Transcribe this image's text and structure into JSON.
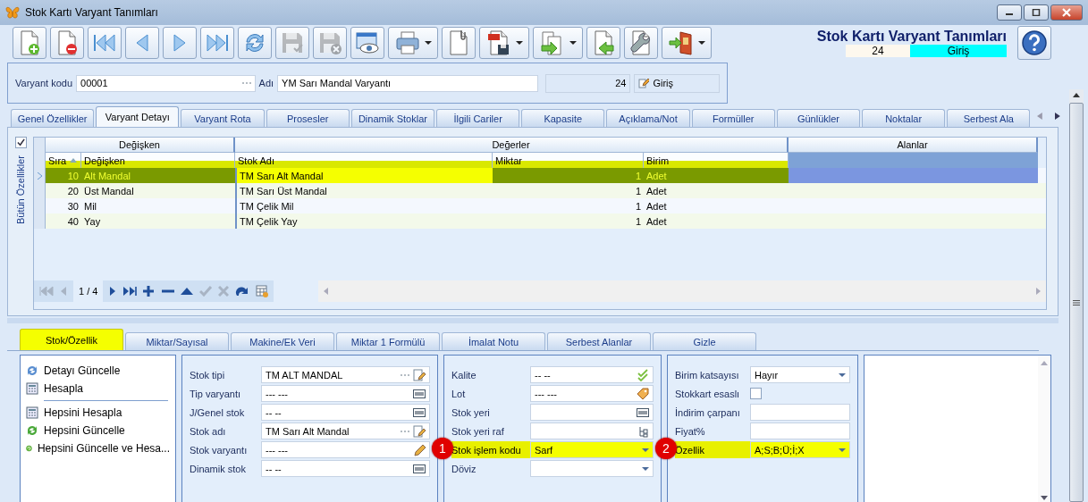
{
  "window": {
    "title": "Stok Kartı Varyant Tanımları"
  },
  "toolbar": [
    {
      "kind": "new",
      "disabled": false,
      "dropdown": false
    },
    {
      "kind": "delete",
      "disabled": false,
      "dropdown": false
    },
    {
      "kind": "first",
      "disabled": false,
      "dropdown": false
    },
    {
      "kind": "prev",
      "disabled": false,
      "dropdown": false
    },
    {
      "kind": "next",
      "disabled": false,
      "dropdown": false
    },
    {
      "kind": "last",
      "disabled": false,
      "dropdown": false
    },
    {
      "kind": "refresh",
      "disabled": false,
      "dropdown": false
    },
    {
      "kind": "save",
      "disabled": true,
      "dropdown": false
    },
    {
      "kind": "cancel",
      "disabled": true,
      "dropdown": false
    },
    {
      "kind": "preview",
      "disabled": false,
      "dropdown": false
    },
    {
      "kind": "print",
      "disabled": false,
      "dropdown": true
    },
    {
      "kind": "attach",
      "disabled": false,
      "dropdown": false
    },
    {
      "kind": "pdf",
      "disabled": false,
      "dropdown": true
    },
    {
      "kind": "export",
      "disabled": false,
      "dropdown": true
    },
    {
      "kind": "import",
      "disabled": false,
      "dropdown": false
    },
    {
      "kind": "tools",
      "disabled": false,
      "dropdown": false
    },
    {
      "kind": "exit",
      "disabled": false,
      "dropdown": true
    }
  ],
  "header": {
    "title": "Stok Kartı Varyant Tanımları",
    "record_no": "24",
    "mode": "Giriş"
  },
  "form": {
    "code_label": "Varyant kodu",
    "code": "00001",
    "name_label": "Adı",
    "name": "YM Sarı Mandal Varyantı",
    "count": "24",
    "mode_button": "Giriş"
  },
  "tabs": [
    {
      "label": "Genel Özellikler",
      "selected": false
    },
    {
      "label": "Varyant Detayı",
      "selected": true
    },
    {
      "label": "Varyant Rota",
      "selected": false
    },
    {
      "label": "Prosesler",
      "selected": false
    },
    {
      "label": "Dinamik Stoklar",
      "selected": false
    },
    {
      "label": "İlgili Cariler",
      "selected": false
    },
    {
      "label": "Kapasite",
      "selected": false
    },
    {
      "label": "Açıklama/Not",
      "selected": false
    },
    {
      "label": "Formüller",
      "selected": false
    },
    {
      "label": "Günlükler",
      "selected": false
    },
    {
      "label": "Noktalar",
      "selected": false
    },
    {
      "label": "Serbest Ala",
      "selected": false
    }
  ],
  "grid": {
    "side_label": "Bütün Özellikler",
    "select_all_checked": true,
    "bands": [
      "Değişken",
      "Değerler",
      "Alanlar"
    ],
    "columns": [
      "Sıra",
      "Değişken",
      "Stok Adı",
      "Miktar",
      "Birim"
    ],
    "rows": [
      {
        "sira": "10",
        "degisken": "Alt Mandal",
        "stok_adi": "TM Sarı Alt Mandal",
        "miktar": "1",
        "birim": "Adet",
        "selected": true
      },
      {
        "sira": "20",
        "degisken": "Üst Mandal",
        "stok_adi": "TM Sarı Üst Mandal",
        "miktar": "1",
        "birim": "Adet",
        "selected": false
      },
      {
        "sira": "30",
        "degisken": "Mil",
        "stok_adi": "TM Çelik Mil",
        "miktar": "1",
        "birim": "Adet",
        "selected": false
      },
      {
        "sira": "40",
        "degisken": "Yay",
        "stok_adi": "TM Çelik Yay",
        "miktar": "1",
        "birim": "Adet",
        "selected": false
      }
    ],
    "page": "1 / 4"
  },
  "lower_tabs": [
    {
      "label": "Stok/Özellik",
      "selected": true
    },
    {
      "label": "Miktar/Sayısal",
      "selected": false
    },
    {
      "label": "Makine/Ek Veri",
      "selected": false
    },
    {
      "label": "Miktar 1 Formülü",
      "selected": false
    },
    {
      "label": "İmalat Notu",
      "selected": false
    },
    {
      "label": "Serbest Alanlar",
      "selected": false
    },
    {
      "label": "Gizle",
      "selected": false
    }
  ],
  "action_groups": [
    [
      {
        "label": "Detayı Güncelle",
        "kind": "refresh"
      },
      {
        "label": "Hesapla",
        "kind": "calc"
      }
    ],
    [
      {
        "label": "Hepsini Hesapla",
        "kind": "calc"
      },
      {
        "label": "Hepsini Güncelle",
        "kind": "sync"
      },
      {
        "label": "Hepsini Güncelle ve Hesa...",
        "kind": "sync-calc"
      }
    ]
  ],
  "field_groups": [
    [
      {
        "label": "Stok tipi",
        "value": "TM ALT MANDAL",
        "kind": "lookup",
        "highlighted": false
      },
      {
        "label": "Tip varyantı",
        "value": "--- ---",
        "kind": "list",
        "highlighted": false
      },
      {
        "label": "J/Genel stok",
        "value": "-- --",
        "kind": "list",
        "highlighted": false
      },
      {
        "label": "Stok adı",
        "value": "TM Sarı Alt Mandal",
        "kind": "lookup",
        "highlighted": false
      },
      {
        "label": "Stok varyantı",
        "value": "--- ---",
        "kind": "pencil",
        "highlighted": false
      },
      {
        "label": "Dinamik stok",
        "value": "-- --",
        "kind": "list",
        "highlighted": false
      }
    ],
    [
      {
        "label": "Kalite",
        "value": "-- --",
        "kind": "check",
        "highlighted": false
      },
      {
        "label": "Lot",
        "value": "--- ---",
        "kind": "tag",
        "highlighted": false
      },
      {
        "label": "Stok yeri",
        "kind": "list",
        "highlighted": false
      },
      {
        "label": "Stok yeri raf",
        "kind": "tree",
        "highlighted": false
      },
      {
        "label": "Stok işlem kodu",
        "value": "Sarf",
        "kind": "combo",
        "highlighted": true,
        "callout": "1"
      },
      {
        "label": "Döviz",
        "kind": "combo",
        "highlighted": false
      }
    ],
    [
      {
        "label": "Birim katsayısı",
        "value": "Hayır",
        "kind": "combo",
        "highlighted": false
      },
      {
        "label": "Stokkart esaslı",
        "kind": "checkbox",
        "checked": false,
        "highlighted": false
      },
      {
        "label": "İndirim çarpanı",
        "kind": "text",
        "highlighted": false
      },
      {
        "label": "Fiyat%",
        "kind": "text",
        "highlighted": false
      },
      {
        "label": "Özellik",
        "value": "A;S;B;Ü;İ;X",
        "kind": "combo",
        "highlighted": true,
        "callout": "2"
      }
    ]
  ]
}
